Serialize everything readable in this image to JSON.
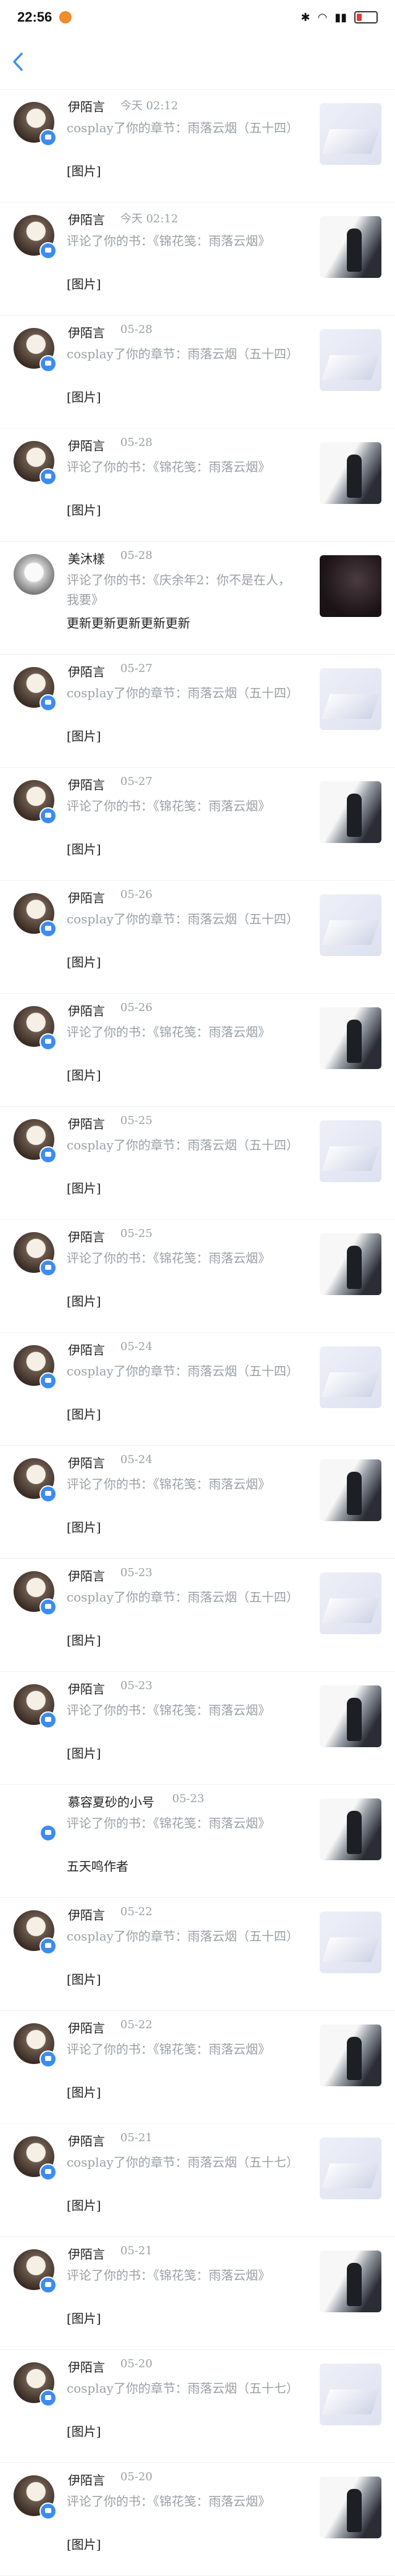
{
  "status": {
    "time": "22:56"
  },
  "items": [
    {
      "name": "伊陌言",
      "date": "今天 02:12",
      "action": "cosplay了你的章节：雨落云烟（五十四）",
      "content": "[图片]",
      "avatar": "dark",
      "thumb": "light"
    },
    {
      "name": "伊陌言",
      "date": "今天 02:12",
      "action": "评论了你的书：《锦花笺：雨落云烟》",
      "content": "[图片]",
      "avatar": "dark",
      "thumb": "dark"
    },
    {
      "name": "伊陌言",
      "date": "05-28",
      "action": "cosplay了你的章节：雨落云烟（五十四）",
      "content": "[图片]",
      "avatar": "dark",
      "thumb": "light"
    },
    {
      "name": "伊陌言",
      "date": "05-28",
      "action": "评论了你的书：《锦花笺：雨落云烟》",
      "content": "[图片]",
      "avatar": "dark",
      "thumb": "dark"
    },
    {
      "name": "美沐樣",
      "date": "05-28",
      "action": "评论了你的书：《庆余年2：你不是在人，我要》",
      "content": "更新更新更新更新更新",
      "avatar": "light",
      "thumb": "black"
    },
    {
      "name": "伊陌言",
      "date": "05-27",
      "action": "cosplay了你的章节：雨落云烟（五十四）",
      "content": "[图片]",
      "avatar": "dark",
      "thumb": "light"
    },
    {
      "name": "伊陌言",
      "date": "05-27",
      "action": "评论了你的书：《锦花笺：雨落云烟》",
      "content": "[图片]",
      "avatar": "dark",
      "thumb": "dark"
    },
    {
      "name": "伊陌言",
      "date": "05-26",
      "action": "cosplay了你的章节：雨落云烟（五十四）",
      "content": "[图片]",
      "avatar": "dark",
      "thumb": "light"
    },
    {
      "name": "伊陌言",
      "date": "05-26",
      "action": "评论了你的书：《锦花笺：雨落云烟》",
      "content": "[图片]",
      "avatar": "dark",
      "thumb": "dark"
    },
    {
      "name": "伊陌言",
      "date": "05-25",
      "action": "cosplay了你的章节：雨落云烟（五十四）",
      "content": "[图片]",
      "avatar": "dark",
      "thumb": "light"
    },
    {
      "name": "伊陌言",
      "date": "05-25",
      "action": "评论了你的书：《锦花笺：雨落云烟》",
      "content": "[图片]",
      "avatar": "dark",
      "thumb": "dark"
    },
    {
      "name": "伊陌言",
      "date": "05-24",
      "action": "cosplay了你的章节：雨落云烟（五十四）",
      "content": "[图片]",
      "avatar": "dark",
      "thumb": "light"
    },
    {
      "name": "伊陌言",
      "date": "05-24",
      "action": "评论了你的书：《锦花笺：雨落云烟》",
      "content": "[图片]",
      "avatar": "dark",
      "thumb": "dark"
    },
    {
      "name": "伊陌言",
      "date": "05-23",
      "action": "cosplay了你的章节：雨落云烟（五十四）",
      "content": "[图片]",
      "avatar": "dark",
      "thumb": "light"
    },
    {
      "name": "伊陌言",
      "date": "05-23",
      "action": "评论了你的书：《锦花笺：雨落云烟》",
      "content": "[图片]",
      "avatar": "dark",
      "thumb": "dark"
    },
    {
      "name": "慕容夏砂的小号",
      "date": "05-23",
      "action": "评论了你的书：《锦花笺：雨落云烟》",
      "content": "五天鸣作者",
      "avatar": "none",
      "thumb": "dark"
    },
    {
      "name": "伊陌言",
      "date": "05-22",
      "action": "cosplay了你的章节：雨落云烟（五十四）",
      "content": "[图片]",
      "avatar": "dark",
      "thumb": "light"
    },
    {
      "name": "伊陌言",
      "date": "05-22",
      "action": "评论了你的书：《锦花笺：雨落云烟》",
      "content": "[图片]",
      "avatar": "dark",
      "thumb": "dark"
    },
    {
      "name": "伊陌言",
      "date": "05-21",
      "action": "cosplay了你的章节：雨落云烟（五十七）",
      "content": "[图片]",
      "avatar": "dark",
      "thumb": "light"
    },
    {
      "name": "伊陌言",
      "date": "05-21",
      "action": "评论了你的书：《锦花笺：雨落云烟》",
      "content": "[图片]",
      "avatar": "dark",
      "thumb": "dark"
    },
    {
      "name": "伊陌言",
      "date": "05-20",
      "action": "cosplay了你的章节：雨落云烟（五十七）",
      "content": "[图片]",
      "avatar": "dark",
      "thumb": "light"
    },
    {
      "name": "伊陌言",
      "date": "05-20",
      "action": "评论了你的书：《锦花笺：雨落云烟》",
      "content": "[图片]",
      "avatar": "dark",
      "thumb": "dark"
    }
  ]
}
